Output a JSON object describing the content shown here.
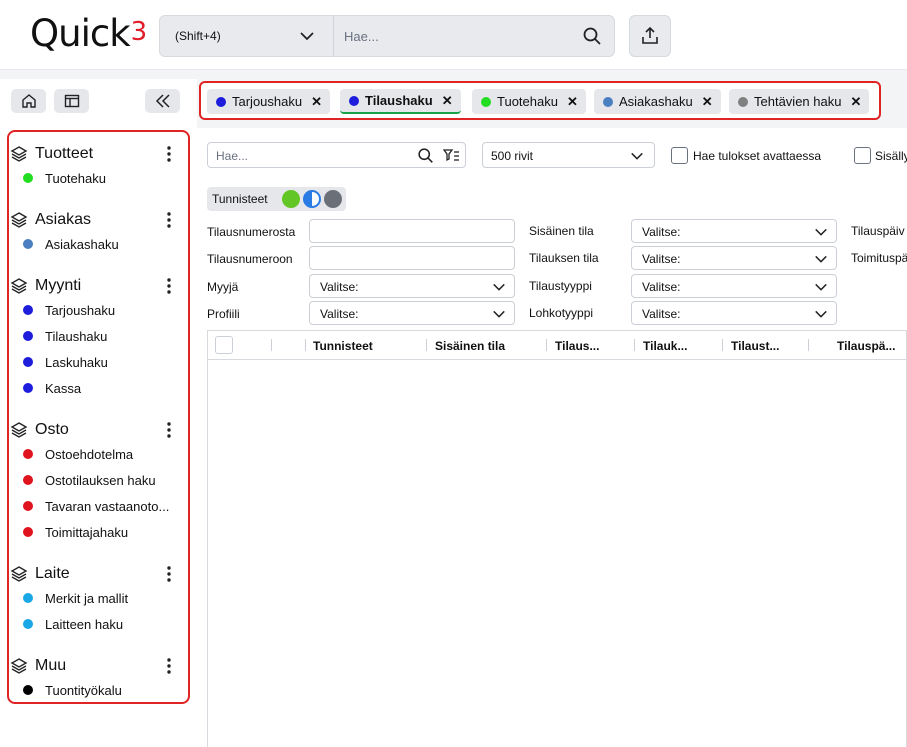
{
  "app": {
    "logo_text": "Quick",
    "logo_sup": "3"
  },
  "topbar": {
    "scope_label": "(Shift+4)",
    "search_placeholder": "Hae..."
  },
  "tabs": [
    {
      "label": "Tarjoushaku",
      "color": "#1d1ddb",
      "active": false
    },
    {
      "label": "Tilaushaku",
      "color": "#1d1ddb",
      "active": true
    },
    {
      "label": "Tuotehaku",
      "color": "#22dd22",
      "active": false
    },
    {
      "label": "Asiakashaku",
      "color": "#4a7fc1",
      "active": false
    },
    {
      "label": "Tehtävien haku",
      "color": "#808080",
      "active": false
    }
  ],
  "sidebar": {
    "groups": [
      {
        "label": "Tuotteet",
        "items": [
          {
            "label": "Tuotehaku",
            "color": "#22dd22"
          }
        ]
      },
      {
        "label": "Asiakas",
        "items": [
          {
            "label": "Asiakashaku",
            "color": "#4a7fc1"
          }
        ]
      },
      {
        "label": "Myynti",
        "items": [
          {
            "label": "Tarjoushaku",
            "color": "#1d1ddb"
          },
          {
            "label": "Tilaushaku",
            "color": "#1d1ddb"
          },
          {
            "label": "Laskuhaku",
            "color": "#1d1ddb"
          },
          {
            "label": "Kassa",
            "color": "#1d1ddb"
          }
        ]
      },
      {
        "label": "Osto",
        "items": [
          {
            "label": "Ostoehdotelma",
            "color": "#e0141e"
          },
          {
            "label": "Ostotilauksen haku",
            "color": "#e0141e"
          },
          {
            "label": "Tavaran vastaanoto...",
            "color": "#e0141e"
          },
          {
            "label": "Toimittajahaku",
            "color": "#e0141e"
          }
        ]
      },
      {
        "label": "Laite",
        "items": [
          {
            "label": "Merkit ja mallit",
            "color": "#1aa7e6"
          },
          {
            "label": "Laitteen haku",
            "color": "#1aa7e6"
          }
        ]
      },
      {
        "label": "Muu",
        "items": [
          {
            "label": "Tuontityökalu",
            "color": "#000000"
          }
        ]
      }
    ]
  },
  "main": {
    "search_placeholder": "Hae...",
    "rows_value": "500 rivit",
    "open_results_label": "Hae tulokset avattaessa",
    "include_label": "Sisälly",
    "tags_label": "Tunnisteet",
    "filters": {
      "col1": [
        "Tilausnumerosta",
        "Tilausnumeroon",
        "Myyjä",
        "Profiili"
      ],
      "col2": [
        "Sisäinen tila",
        "Tilauksen tila",
        "Tilaustyyppi",
        "Lohkotyyppi"
      ],
      "col3": [
        "Tilauspäiv",
        "Toimituspä"
      ],
      "select_placeholder": "Valitse:"
    },
    "columns": [
      "Tunnisteet",
      "Sisäinen tila",
      "Tilaus...",
      "Tilauk...",
      "Tilaust...",
      "Tilauspä..."
    ]
  }
}
